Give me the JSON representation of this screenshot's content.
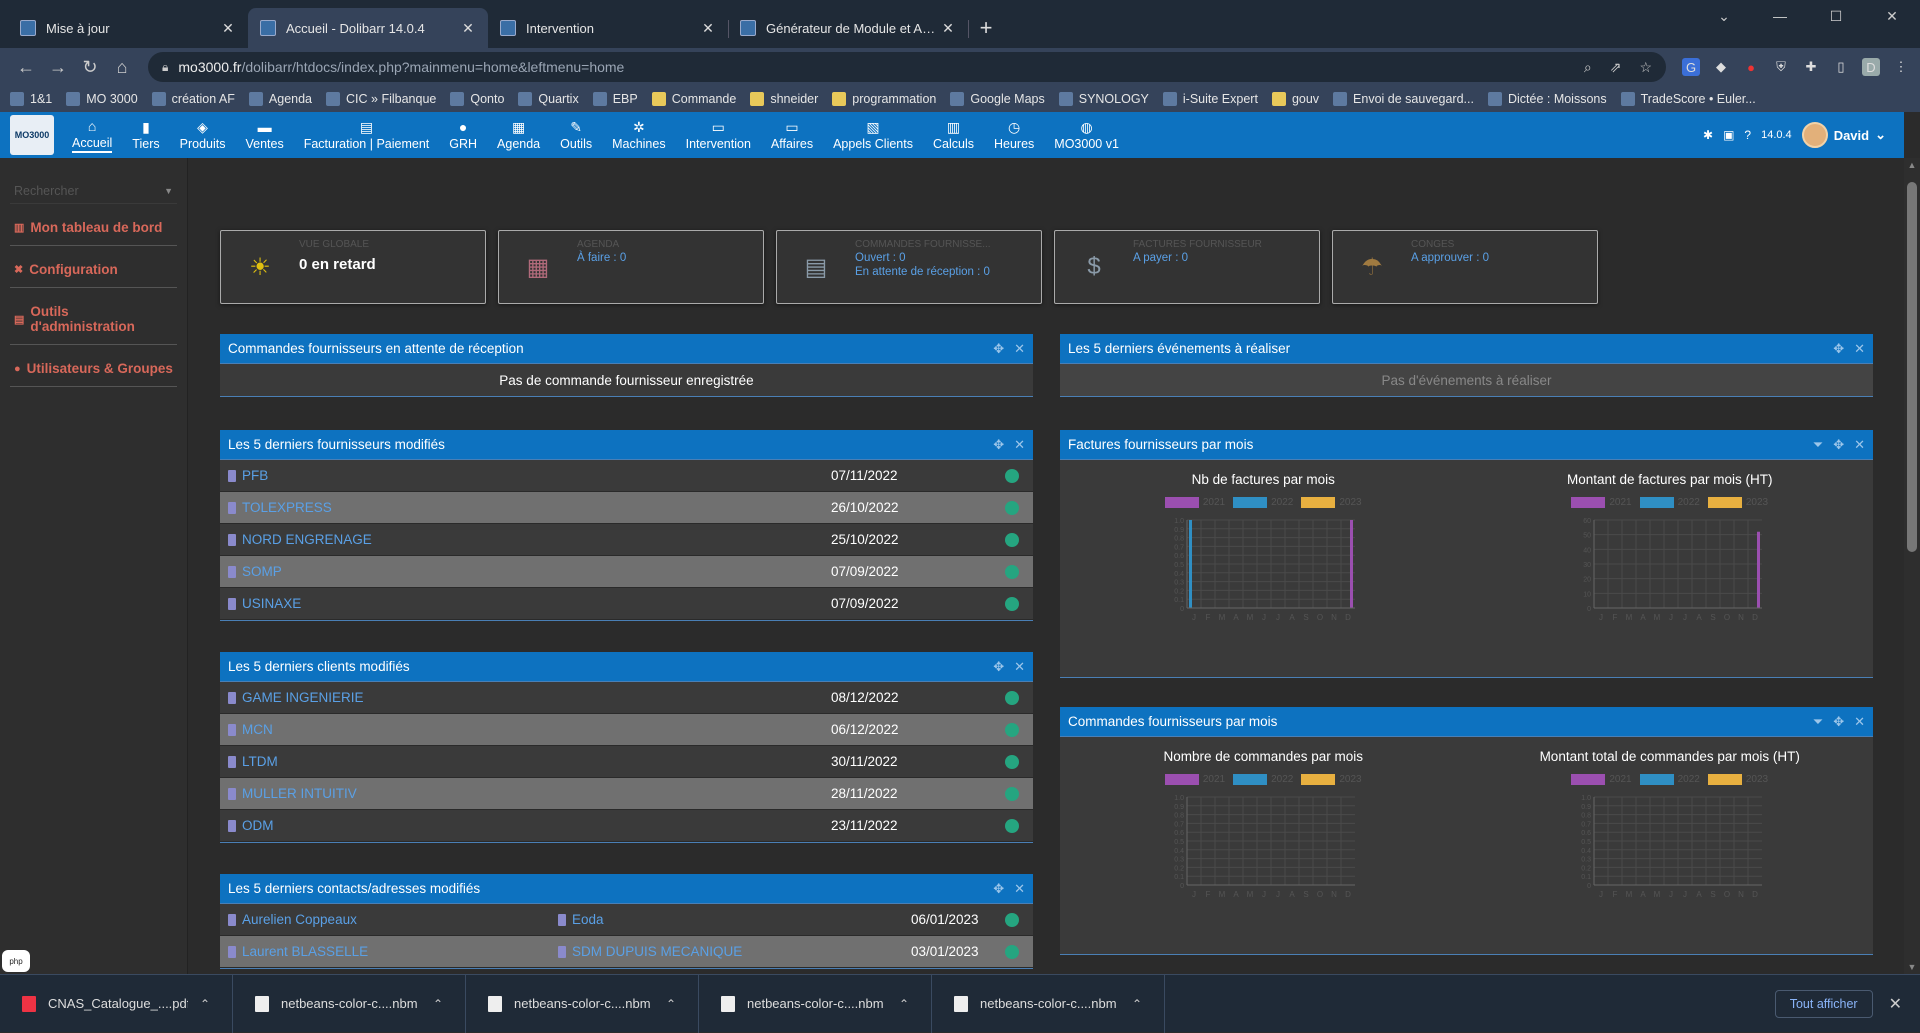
{
  "browser": {
    "tabs": [
      {
        "title": "Mise à jour",
        "active": false
      },
      {
        "title": "Accueil - Dolibarr 14.0.4",
        "active": true
      },
      {
        "title": "Intervention",
        "active": false
      },
      {
        "title": "Générateur de Module et Applica",
        "active": false
      }
    ],
    "url_host": "mo3000.fr",
    "url_path": "/dolibarr/htdocs/index.php?mainmenu=home&leftmenu=home",
    "profile_initial": "D",
    "bookmarks": [
      "1&1",
      "MO 3000",
      "création AF",
      "Agenda",
      "CIC » Filbanque",
      "Qonto",
      "Quartix",
      "EBP",
      "Commande",
      "shneider",
      "programmation",
      "Google Maps",
      "SYNOLOGY",
      "i-Suite Expert",
      "gouv",
      "Envoi de sauvegard...",
      "Dictée : Moissons",
      "TradeScore • Euler..."
    ]
  },
  "app": {
    "logo_text": "MO3000",
    "menu": [
      {
        "label": "Accueil",
        "icon": "home-icon",
        "glyph": "⌂"
      },
      {
        "label": "Tiers",
        "icon": "building-icon",
        "glyph": "▮"
      },
      {
        "label": "Produits",
        "icon": "cube-icon",
        "glyph": "◈"
      },
      {
        "label": "Ventes",
        "icon": "briefcase-icon",
        "glyph": "▬"
      },
      {
        "label": "Facturation | Paiement",
        "icon": "money-icon",
        "glyph": "▤"
      },
      {
        "label": "GRH",
        "icon": "user-icon",
        "glyph": "●"
      },
      {
        "label": "Agenda",
        "icon": "calendar-icon",
        "glyph": "▦"
      },
      {
        "label": "Outils",
        "icon": "wrench-icon",
        "glyph": "✎"
      },
      {
        "label": "Machines",
        "icon": "gears-icon",
        "glyph": "✲"
      },
      {
        "label": "Intervention",
        "icon": "file-icon",
        "glyph": "▭"
      },
      {
        "label": "Affaires",
        "icon": "file-icon",
        "glyph": "▭"
      },
      {
        "label": "Appels Clients",
        "icon": "chart-icon",
        "glyph": "▧"
      },
      {
        "label": "Calculs",
        "icon": "calculator-icon",
        "glyph": "▥"
      },
      {
        "label": "Heures",
        "icon": "clock-icon",
        "glyph": "◷"
      },
      {
        "label": "MO3000 v1",
        "icon": "globe-icon",
        "glyph": "◍"
      }
    ],
    "version": "14.0.4",
    "user": "David"
  },
  "sidebar": {
    "search_placeholder": "Rechercher",
    "items": [
      {
        "label": "Mon tableau de bord",
        "glyph": "▥"
      },
      {
        "label": "Configuration",
        "glyph": "✖"
      },
      {
        "label": "Outils d'administration",
        "glyph": "▤"
      },
      {
        "label": "Utilisateurs & Groupes",
        "glyph": "●"
      }
    ],
    "php_badge": "php"
  },
  "boxes": [
    {
      "title": "VUE GLOBALE",
      "lines": [],
      "big": "0 en retard",
      "icon": "sun-icon",
      "glyph": "☀",
      "color": "#e0c010"
    },
    {
      "title": "AGENDA",
      "lines": [
        "À faire : 0"
      ],
      "big": "",
      "icon": "calendar-icon",
      "glyph": "▦",
      "color": "#b06a7a"
    },
    {
      "title": "COMMANDES FOURNISSE...",
      "lines": [
        "Ouvert : 0",
        "En attente de réception : 0"
      ],
      "big": "",
      "icon": "document-icon",
      "glyph": "▤",
      "color": "#8a9aa8"
    },
    {
      "title": "FACTURES FOURNISSEUR",
      "lines": [
        "A payer : 0"
      ],
      "big": "",
      "icon": "invoice-icon",
      "glyph": "$",
      "color": "#8a9aa8"
    },
    {
      "title": "CONGES",
      "lines": [
        "A approuver : 0"
      ],
      "big": "",
      "icon": "umbrella-beach-icon",
      "glyph": "☂",
      "color": "#a07a40"
    }
  ],
  "panels": {
    "orders_pending": {
      "title": "Commandes fournisseurs en attente de réception",
      "empty": "Pas de commande fournisseur enregistrée"
    },
    "events": {
      "title": "Les 5 derniers événements à réaliser",
      "empty": "Pas d'événements à réaliser"
    },
    "suppliers": {
      "title": "Les 5 derniers fournisseurs modifiés",
      "rows": [
        {
          "name": "PFB",
          "date": "07/11/2022"
        },
        {
          "name": "TOLEXPRESS",
          "date": "26/10/2022"
        },
        {
          "name": "NORD ENGRENAGE",
          "date": "25/10/2022"
        },
        {
          "name": "SOMP",
          "date": "07/09/2022"
        },
        {
          "name": "USINAXE",
          "date": "07/09/2022"
        }
      ]
    },
    "clients": {
      "title": "Les 5 derniers clients modifiés",
      "rows": [
        {
          "name": "GAME INGENIERIE",
          "date": "08/12/2022"
        },
        {
          "name": "MCN",
          "date": "06/12/2022"
        },
        {
          "name": "LTDM",
          "date": "30/11/2022"
        },
        {
          "name": "MULLER INTUITIV",
          "date": "28/11/2022"
        },
        {
          "name": "ODM",
          "date": "23/11/2022"
        }
      ]
    },
    "contacts": {
      "title": "Les 5 derniers contacts/adresses modifiés",
      "rows": [
        {
          "name": "Aurelien Coppeaux",
          "company": "Eoda",
          "date": "06/01/2023"
        },
        {
          "name": "Laurent BLASSELLE",
          "company": "SDM DUPUIS MECANIQUE",
          "date": "03/01/2023"
        }
      ]
    },
    "invoices_month": {
      "title": "Factures fournisseurs par mois"
    },
    "orders_month": {
      "title": "Commandes fournisseurs par mois"
    }
  },
  "chart_data": [
    {
      "type": "bar",
      "title": "Nb de factures par mois",
      "categories": [
        "J",
        "F",
        "M",
        "A",
        "M",
        "J",
        "J",
        "A",
        "S",
        "O",
        "N",
        "D"
      ],
      "ylim": [
        0,
        1.0
      ],
      "yticks": [
        "0",
        "0.1",
        "0.2",
        "0.3",
        "0.4",
        "0.5",
        "0.6",
        "0.7",
        "0.8",
        "0.9",
        "1.0"
      ],
      "series": [
        {
          "name": "2021",
          "color": "#9b4fb0",
          "values": [
            0,
            0,
            0,
            0,
            0,
            0,
            0,
            0,
            0,
            0,
            0,
            1
          ]
        },
        {
          "name": "2022",
          "color": "#2f8fc4",
          "values": [
            1,
            0,
            0,
            0,
            0,
            0,
            0,
            0,
            0,
            0,
            0,
            0
          ]
        },
        {
          "name": "2023",
          "color": "#e8b040",
          "values": [
            0,
            0,
            0,
            0,
            0,
            0,
            0,
            0,
            0,
            0,
            0,
            0
          ]
        }
      ]
    },
    {
      "type": "bar",
      "title": "Montant de factures par mois (HT)",
      "categories": [
        "J",
        "F",
        "M",
        "A",
        "M",
        "J",
        "J",
        "A",
        "S",
        "O",
        "N",
        "D"
      ],
      "ylim": [
        0,
        60
      ],
      "yticks": [
        "0",
        "10",
        "20",
        "30",
        "40",
        "50",
        "60"
      ],
      "series": [
        {
          "name": "2021",
          "color": "#9b4fb0",
          "values": [
            0,
            0,
            0,
            0,
            0,
            0,
            0,
            0,
            0,
            0,
            0,
            52
          ]
        },
        {
          "name": "2022",
          "color": "#2f8fc4",
          "values": [
            0,
            0,
            0,
            0,
            0,
            0,
            0,
            0,
            0,
            0,
            0,
            0
          ]
        },
        {
          "name": "2023",
          "color": "#e8b040",
          "values": [
            0,
            0,
            0,
            0,
            0,
            0,
            0,
            0,
            0,
            0,
            0,
            0
          ]
        }
      ]
    },
    {
      "type": "bar",
      "title": "Nombre de commandes par mois",
      "categories": [
        "J",
        "F",
        "M",
        "A",
        "M",
        "J",
        "J",
        "A",
        "S",
        "O",
        "N",
        "D"
      ],
      "ylim": [
        0,
        1.0
      ],
      "yticks": [
        "0",
        "0.1",
        "0.2",
        "0.3",
        "0.4",
        "0.5",
        "0.6",
        "0.7",
        "0.8",
        "0.9",
        "1.0"
      ],
      "series": [
        {
          "name": "2021",
          "color": "#9b4fb0",
          "values": [
            0,
            0,
            0,
            0,
            0,
            0,
            0,
            0,
            0,
            0,
            0,
            0
          ]
        },
        {
          "name": "2022",
          "color": "#2f8fc4",
          "values": [
            0,
            0,
            0,
            0,
            0,
            0,
            0,
            0,
            0,
            0,
            0,
            0
          ]
        },
        {
          "name": "2023",
          "color": "#e8b040",
          "values": [
            0,
            0,
            0,
            0,
            0,
            0,
            0,
            0,
            0,
            0,
            0,
            0
          ]
        }
      ]
    },
    {
      "type": "bar",
      "title": "Montant total de commandes par mois (HT)",
      "categories": [
        "J",
        "F",
        "M",
        "A",
        "M",
        "J",
        "J",
        "A",
        "S",
        "O",
        "N",
        "D"
      ],
      "ylim": [
        0,
        1.0
      ],
      "yticks": [
        "0",
        "0.1",
        "0.2",
        "0.3",
        "0.4",
        "0.5",
        "0.6",
        "0.7",
        "0.8",
        "0.9",
        "1.0"
      ],
      "series": [
        {
          "name": "2021",
          "color": "#9b4fb0",
          "values": [
            0,
            0,
            0,
            0,
            0,
            0,
            0,
            0,
            0,
            0,
            0,
            0
          ]
        },
        {
          "name": "2022",
          "color": "#2f8fc4",
          "values": [
            0,
            0,
            0,
            0,
            0,
            0,
            0,
            0,
            0,
            0,
            0,
            0
          ]
        },
        {
          "name": "2023",
          "color": "#e8b040",
          "values": [
            0,
            0,
            0,
            0,
            0,
            0,
            0,
            0,
            0,
            0,
            0,
            0
          ]
        }
      ]
    }
  ],
  "downloads": {
    "items": [
      {
        "name": "CNAS_Catalogue_....pdf",
        "pdf": true
      },
      {
        "name": "netbeans-color-c....nbm",
        "pdf": false
      },
      {
        "name": "netbeans-color-c....nbm",
        "pdf": false
      },
      {
        "name": "netbeans-color-c....nbm",
        "pdf": false
      },
      {
        "name": "netbeans-color-c....nbm",
        "pdf": false
      }
    ],
    "show_all": "Tout afficher"
  }
}
